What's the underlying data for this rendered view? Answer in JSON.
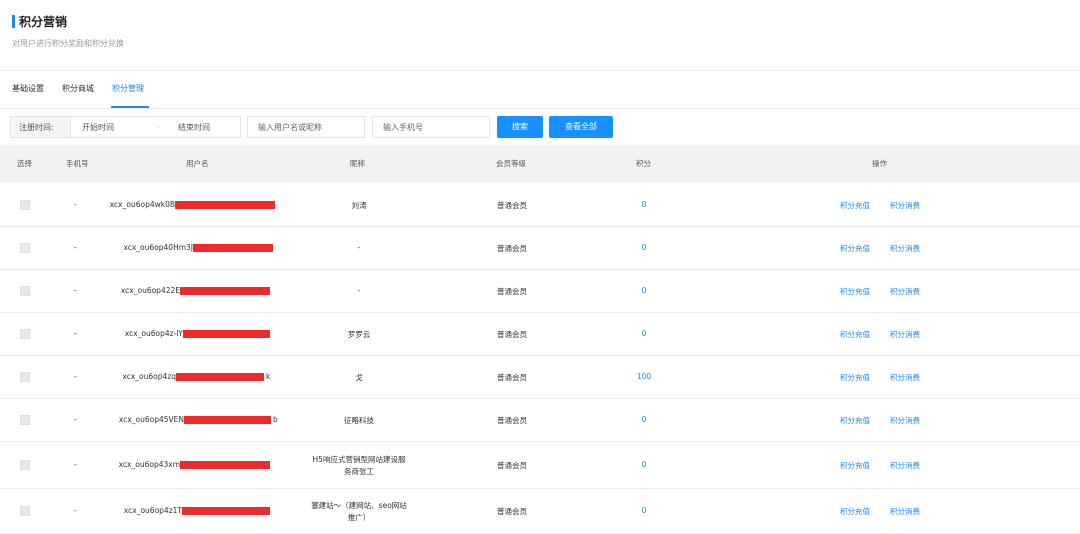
{
  "header": {
    "title": "积分营销",
    "subtitle": "对用户进行积分奖励和积分兑换"
  },
  "tabs": [
    {
      "label": "基础设置",
      "active": false
    },
    {
      "label": "积分商城",
      "active": false
    },
    {
      "label": "积分管理",
      "active": true
    }
  ],
  "filters": {
    "label": "注册时间:",
    "start_placeholder": "开始时间",
    "separator": "-",
    "end_placeholder": "结束时间",
    "user_placeholder": "输入用户名或昵称",
    "phone_placeholder": "输入手机号",
    "search_label": "搜索",
    "all_label": "查看全部"
  },
  "table": {
    "columns": [
      "选择",
      "手机号",
      "用户名",
      "昵称",
      "会员等级",
      "积分",
      "操作"
    ],
    "actions": {
      "recharge": "积分充值",
      "consume": "积分消费"
    },
    "rows": [
      {
        "phone": "-",
        "username": "xcx_ou6op4wk0B",
        "nickname": "刘涛",
        "nickname2": "",
        "level": "普通会员",
        "points": "0"
      },
      {
        "phone": "-",
        "username": "xcx_ou6op40Hm3J",
        "nickname": "-",
        "nickname2": "",
        "level": "普通会员",
        "points": "0"
      },
      {
        "phone": "-",
        "username": "xcx_ou6op422E",
        "nickname": "-",
        "nickname2": "",
        "level": "普通会员",
        "points": "0"
      },
      {
        "phone": "-",
        "username": "xcx_ou6op4z-lY",
        "nickname": "罗罗云",
        "nickname2": "",
        "level": "普通会员",
        "points": "0"
      },
      {
        "phone": "-",
        "username": "xcx_ou6op4zq",
        "username_tail": "k",
        "nickname": "戈",
        "nickname2": "",
        "level": "普通会员",
        "points": "100"
      },
      {
        "phone": "-",
        "username": "xcx_ou6op45VEN",
        "username_tail": "b",
        "nickname": "征略科技",
        "nickname2": "",
        "level": "普通会员",
        "points": "0"
      },
      {
        "phone": "-",
        "username": "xcx_ou6op43xm",
        "nickname": "H5响应式营销型网站建设服",
        "nickname2": "务商张工",
        "level": "普通会员",
        "points": "0"
      },
      {
        "phone": "-",
        "username": "xcx_ou6op4z1T",
        "nickname": "塞建站～（建网站、seo网站",
        "nickname2": "推广）",
        "level": "普通会员",
        "points": "0"
      }
    ]
  },
  "colors": {
    "accent": "#1890ff",
    "link": "#1e88e5",
    "redaction": "#ee2b2b"
  }
}
